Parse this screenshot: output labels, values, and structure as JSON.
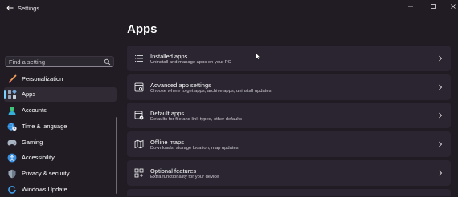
{
  "window": {
    "title": "Settings"
  },
  "search": {
    "placeholder": "Find a setting"
  },
  "sidebar": {
    "items": [
      {
        "label": "Personalization",
        "icon": "brush-icon"
      },
      {
        "label": "Apps",
        "icon": "apps-icon",
        "selected": true
      },
      {
        "label": "Accounts",
        "icon": "person-icon"
      },
      {
        "label": "Time & language",
        "icon": "globe-clock-icon"
      },
      {
        "label": "Gaming",
        "icon": "gamepad-icon"
      },
      {
        "label": "Accessibility",
        "icon": "accessibility-icon"
      },
      {
        "label": "Privacy & security",
        "icon": "shield-icon"
      },
      {
        "label": "Windows Update",
        "icon": "update-icon"
      }
    ]
  },
  "main": {
    "title": "Apps",
    "cards": [
      {
        "title": "Installed apps",
        "subtitle": "Uninstall and manage apps on your PC",
        "icon": "installed-apps-icon"
      },
      {
        "title": "Advanced app settings",
        "subtitle": "Choose where to get apps, archive apps, uninstall updates",
        "icon": "advanced-app-settings-icon"
      },
      {
        "title": "Default apps",
        "subtitle": "Defaults for file and link types, other defaults",
        "icon": "default-apps-icon"
      },
      {
        "title": "Offline maps",
        "subtitle": "Downloads, storage location, map updates",
        "icon": "map-icon"
      },
      {
        "title": "Optional features",
        "subtitle": "Extra functionality for your device",
        "icon": "optional-features-icon"
      }
    ]
  },
  "colors": {
    "accent": "#7ad0ff",
    "background": "#211c24",
    "card": "#2a2530"
  }
}
